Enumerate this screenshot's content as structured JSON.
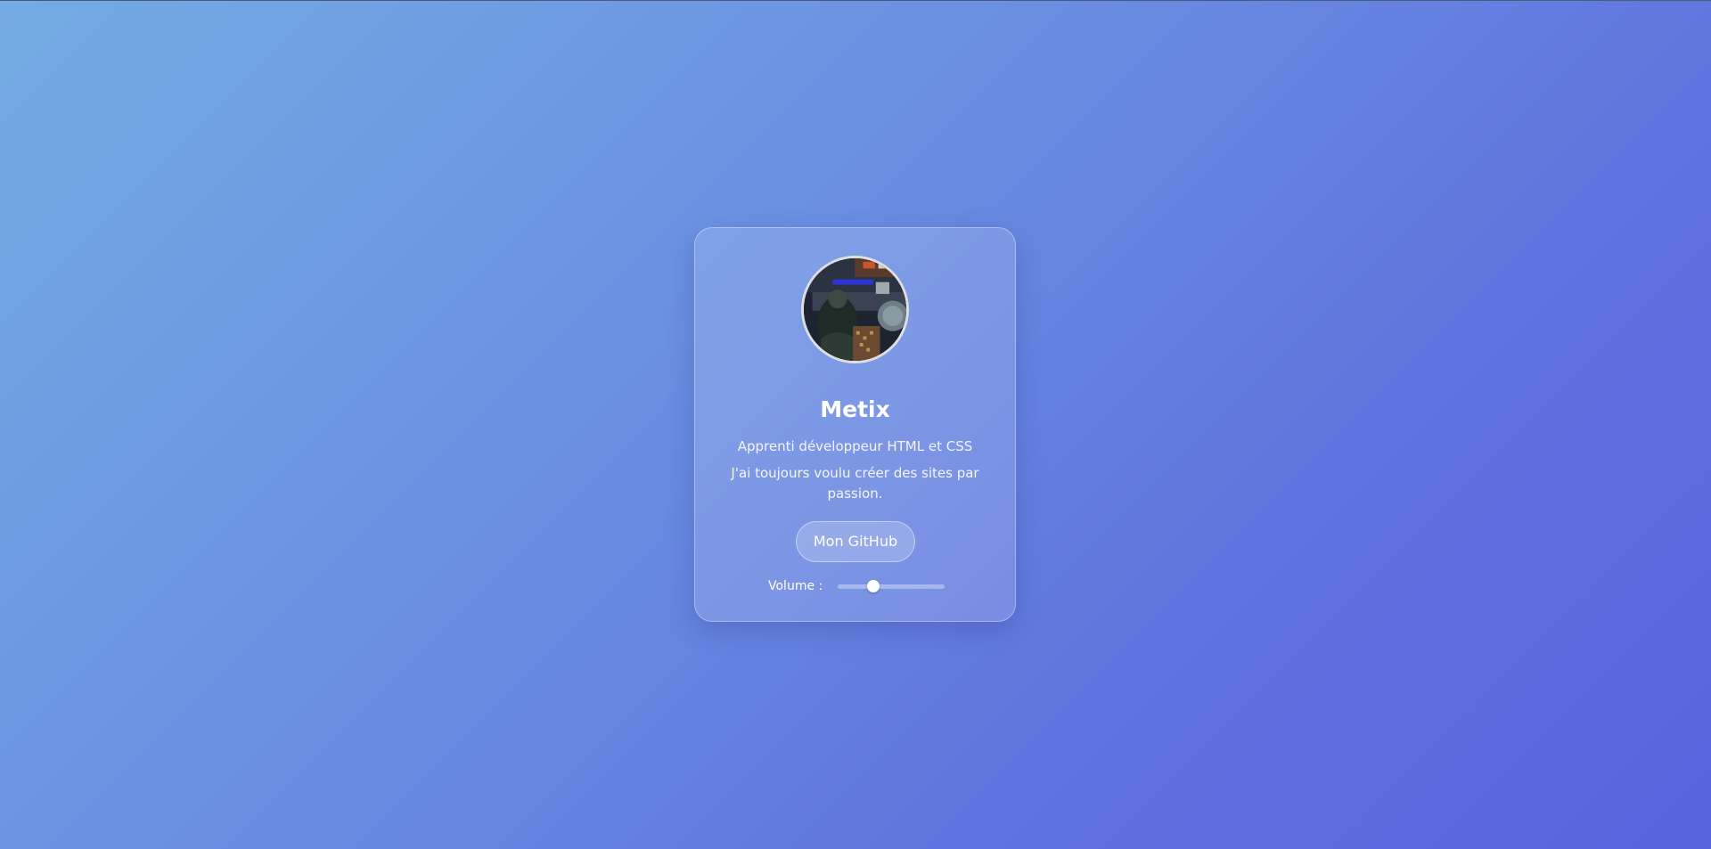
{
  "profile": {
    "name": "Metix",
    "role": "Apprenti développeur HTML et CSS",
    "bio": "J'ai toujours voulu créer des sites par passion.",
    "avatar_icon": "profile-photo"
  },
  "github_button": {
    "label": "Mon GitHub"
  },
  "volume": {
    "label": "Volume :",
    "value": 0.33
  },
  "colors": {
    "background_start": "#73ace2",
    "background_end": "#5863de",
    "card_text": "#ffffff"
  }
}
